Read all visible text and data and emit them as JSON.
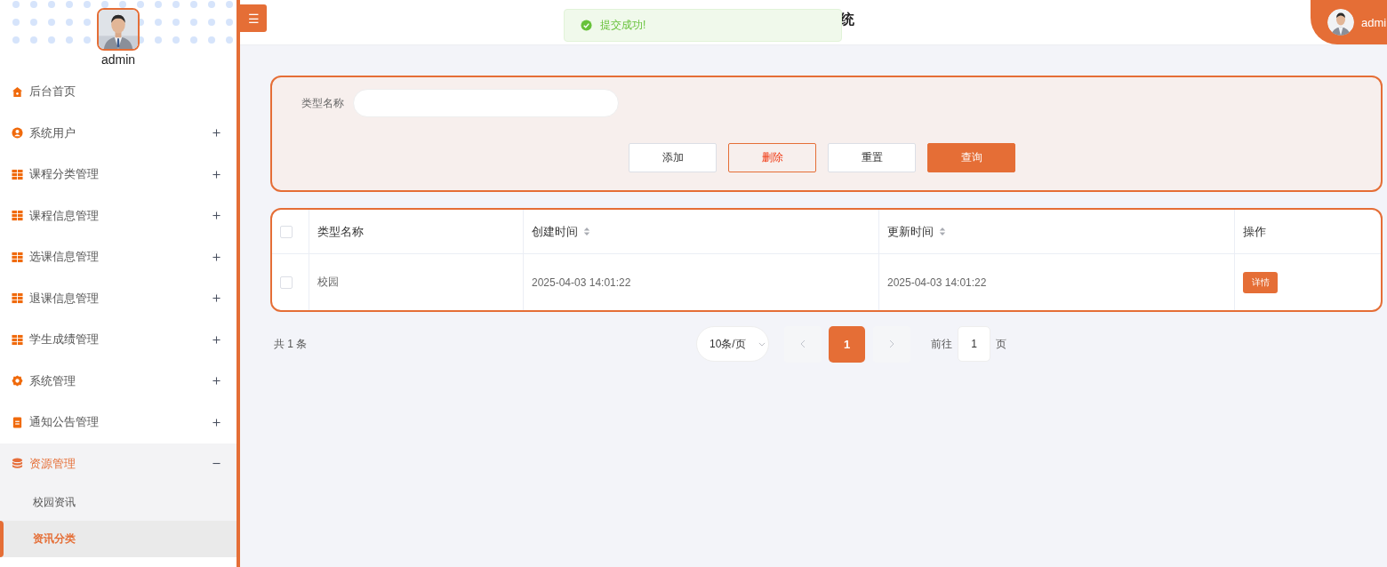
{
  "sidebar": {
    "username": "admin",
    "items": [
      {
        "label": "后台首页"
      },
      {
        "label": "系统用户",
        "expanded": false
      },
      {
        "label": "课程分类管理",
        "expanded": false
      },
      {
        "label": "课程信息管理",
        "expanded": false
      },
      {
        "label": "选课信息管理",
        "expanded": false
      },
      {
        "label": "退课信息管理",
        "expanded": false
      },
      {
        "label": "学生成绩管理",
        "expanded": false
      },
      {
        "label": "系统管理",
        "expanded": false
      },
      {
        "label": "通知公告管理",
        "expanded": false
      },
      {
        "label": "资源管理",
        "expanded": true,
        "children": [
          {
            "label": "校园资讯",
            "selected": false
          },
          {
            "label": "资讯分类",
            "selected": true
          }
        ]
      }
    ]
  },
  "header": {
    "menu_button": "☰",
    "title": "统",
    "user": "admi"
  },
  "toast": {
    "message": "提交成功!"
  },
  "search": {
    "label": "类型名称",
    "buttons": [
      {
        "label": "添加",
        "kind": "default"
      },
      {
        "label": "删除",
        "kind": "danger"
      },
      {
        "label": "重置",
        "kind": "default"
      },
      {
        "label": "查询",
        "kind": "primary"
      }
    ]
  },
  "table": {
    "select_all_checked": false,
    "columns": [
      {
        "label": "类型名称",
        "sortable": false
      },
      {
        "label": "创建时间",
        "sortable": true
      },
      {
        "label": "更新时间",
        "sortable": true
      },
      {
        "label": "操作",
        "sortable": false
      }
    ],
    "rows": [
      {
        "checked": false,
        "cells": [
          "校园",
          "2025-04-03 14:01:22",
          "2025-04-03 14:01:22"
        ],
        "action": "详情"
      }
    ]
  },
  "pagination": {
    "total": "共 1 条",
    "page_size": "10条/页",
    "pages": [
      {
        "label": "1",
        "selected": true
      }
    ],
    "goto_label": "前往",
    "goto_value": "1",
    "goto_suffix": "页"
  }
}
